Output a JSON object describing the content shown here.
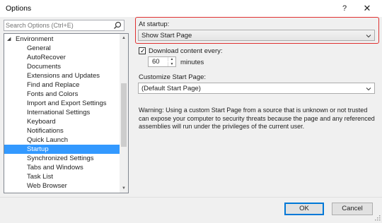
{
  "window": {
    "title": "Options",
    "help": "?",
    "close": "✕"
  },
  "search": {
    "placeholder": "Search Options (Ctrl+E)"
  },
  "tree": {
    "root": {
      "label": "Environment",
      "expander": "◢"
    },
    "items": [
      {
        "label": "General"
      },
      {
        "label": "AutoRecover"
      },
      {
        "label": "Documents"
      },
      {
        "label": "Extensions and Updates"
      },
      {
        "label": "Find and Replace"
      },
      {
        "label": "Fonts and Colors"
      },
      {
        "label": "Import and Export Settings"
      },
      {
        "label": "International Settings"
      },
      {
        "label": "Keyboard"
      },
      {
        "label": "Notifications"
      },
      {
        "label": "Quick Launch"
      },
      {
        "label": "Startup",
        "selected": true
      },
      {
        "label": "Synchronized Settings"
      },
      {
        "label": "Tabs and Windows"
      },
      {
        "label": "Task List"
      },
      {
        "label": "Web Browser"
      }
    ],
    "scroll_up": "▲",
    "scroll_down": "▼"
  },
  "startup": {
    "label": "At startup:",
    "value": "Show Start Page",
    "highlight_color": "#e03030"
  },
  "download": {
    "checkbox_label": "Download content every:",
    "checked": true,
    "check_mark": "✓",
    "interval_value": "60",
    "interval_unit": "minutes",
    "spin_up": "▲",
    "spin_down": "▼"
  },
  "customize": {
    "label": "Customize Start Page:",
    "value": "(Default Start Page)"
  },
  "warning_text": "Warning: Using a custom Start Page from a source that is unknown or not trusted can expose your computer to security threats because the page and any referenced assemblies will run under the privileges of the current user.",
  "buttons": {
    "ok": "OK",
    "cancel": "Cancel"
  },
  "colors": {
    "selection": "#3399ff",
    "default_button_border": "#0078d7"
  }
}
